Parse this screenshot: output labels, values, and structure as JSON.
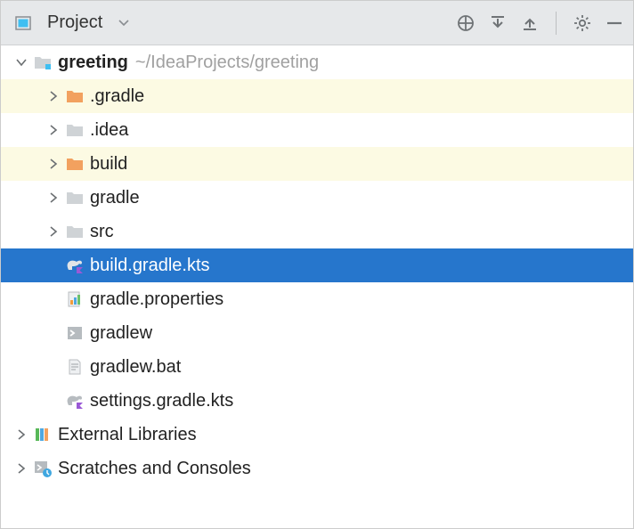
{
  "header": {
    "title": "Project"
  },
  "tree": {
    "root": {
      "name": "greeting",
      "path": "~/IdeaProjects/greeting"
    },
    "children": [
      {
        "name": ".gradle"
      },
      {
        "name": ".idea"
      },
      {
        "name": "build"
      },
      {
        "name": "gradle"
      },
      {
        "name": "src"
      },
      {
        "name": "build.gradle.kts"
      },
      {
        "name": "gradle.properties"
      },
      {
        "name": "gradlew"
      },
      {
        "name": "gradlew.bat"
      },
      {
        "name": "settings.gradle.kts"
      }
    ],
    "externalLibraries": "External Libraries",
    "scratches": "Scratches and Consoles"
  }
}
